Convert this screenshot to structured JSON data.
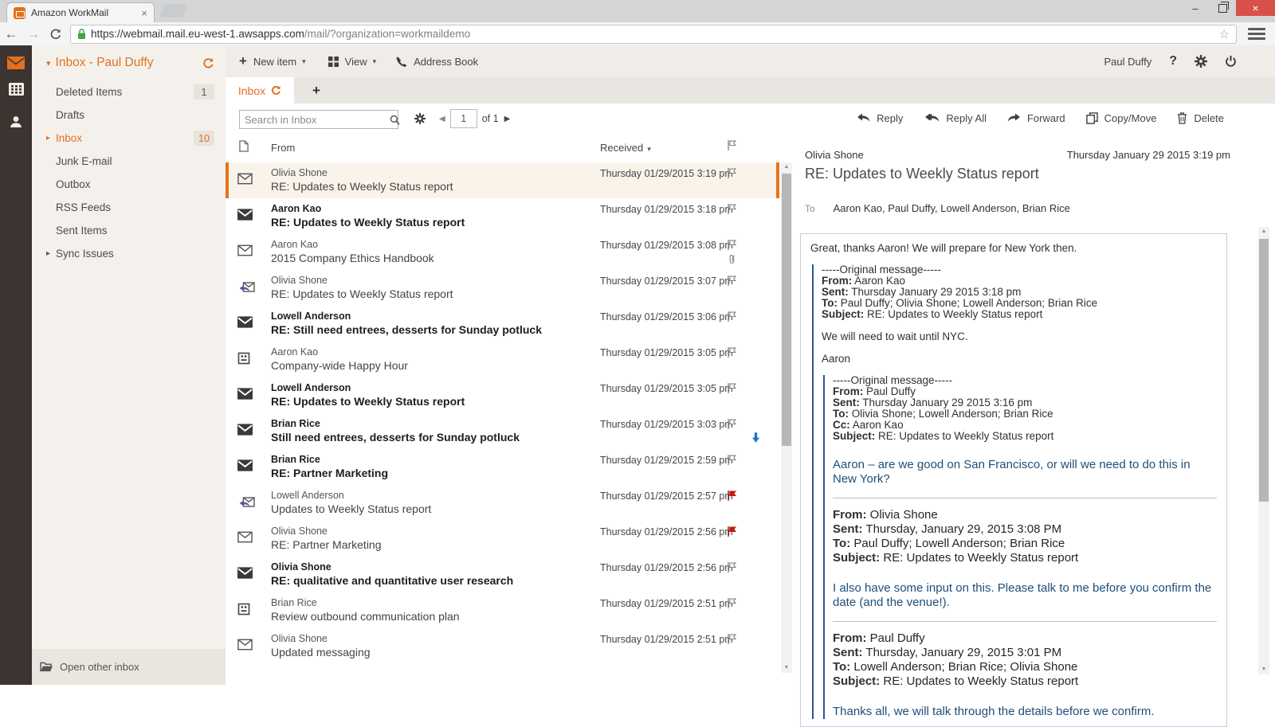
{
  "chrome": {
    "tab_title": "Amazon WorkMail",
    "url_host": "https://webmail.mail.eu-west-1.awsapps.com",
    "url_path": "/mail/?organization=workmaildemo",
    "window": {
      "minimize": "–",
      "close": "×"
    },
    "nav": {
      "back": "←",
      "forward": "→",
      "star": "☆"
    }
  },
  "icons": {
    "caret_down": "▾",
    "arrow_right_small": "▸",
    "prev_page": "◀",
    "next_page": "▶",
    "scroll_up": "▲",
    "scroll_down": "▼",
    "help": "?",
    "plus": "+",
    "tab_close": "×"
  },
  "sidebar": {
    "header": "Inbox - Paul Duffy",
    "folders": [
      {
        "label": "Deleted Items",
        "badge": "1",
        "state": ""
      },
      {
        "label": "Drafts",
        "state": ""
      },
      {
        "label": "Inbox",
        "badge": "10",
        "state": "active has-arrow"
      },
      {
        "label": "Junk E-mail",
        "state": ""
      },
      {
        "label": "Outbox",
        "state": ""
      },
      {
        "label": "RSS Feeds",
        "state": ""
      },
      {
        "label": "Sent Items",
        "state": ""
      },
      {
        "label": "Sync Issues",
        "state": "has-arrow"
      }
    ],
    "footer": "Open other inbox"
  },
  "toolbar": {
    "new_item": "New item",
    "view": "View",
    "address_book": "Address Book",
    "user": "Paul Duffy"
  },
  "tabs": {
    "active": "Inbox"
  },
  "list": {
    "search_placeholder": "Search in Inbox",
    "page": "1",
    "page_of": "of 1",
    "columns": {
      "from": "From",
      "received": "Received"
    },
    "emails": [
      {
        "from": "Olivia Shone",
        "subject": "RE: Updates to Weekly Status report",
        "received": "Thursday 01/29/2015 3:19 pm",
        "state": "read selected"
      },
      {
        "from": "Aaron Kao",
        "subject": "RE: Updates to Weekly Status report",
        "received": "Thursday 01/29/2015 3:18 pm",
        "state": "unread"
      },
      {
        "from": "Aaron Kao",
        "subject": "2015 Company Ethics Handbook",
        "received": "Thursday 01/29/2015 3:08 pm",
        "state": "read attachment"
      },
      {
        "from": "Olivia Shone",
        "subject": "RE: Updates to Weekly Status report",
        "received": "Thursday 01/29/2015 3:07 pm",
        "state": "replied"
      },
      {
        "from": "Lowell Anderson",
        "subject": "RE: Still need entrees, desserts for Sunday potluck",
        "received": "Thursday 01/29/2015 3:06 pm",
        "state": "unread"
      },
      {
        "from": "Aaron Kao",
        "subject": "Company-wide Happy Hour",
        "received": "Thursday 01/29/2015 3:05 pm",
        "state": "meeting"
      },
      {
        "from": "Lowell Anderson",
        "subject": "RE: Updates to Weekly Status report",
        "received": "Thursday 01/29/2015 3:05 pm",
        "state": "unread"
      },
      {
        "from": "Brian Rice",
        "subject": "Still need entrees, desserts for Sunday potluck",
        "received": "Thursday 01/29/2015 3:03 pm",
        "state": "unread low-importance"
      },
      {
        "from": "Brian Rice",
        "subject": "RE: Partner Marketing",
        "received": "Thursday 01/29/2015 2:59 pm",
        "state": "unread"
      },
      {
        "from": "Lowell Anderson",
        "subject": "Updates to Weekly Status report",
        "received": "Thursday 01/29/2015 2:57 pm",
        "state": "replied flagged"
      },
      {
        "from": "Olivia Shone",
        "subject": "RE: Partner Marketing",
        "received": "Thursday 01/29/2015 2:56 pm",
        "state": "read flagged"
      },
      {
        "from": "Olivia Shone",
        "subject": "RE: qualitative and quantitative user research",
        "received": "Thursday 01/29/2015 2:56 pm",
        "state": "unread"
      },
      {
        "from": "Brian Rice",
        "subject": "Review outbound communication plan",
        "received": "Thursday 01/29/2015 2:51 pm",
        "state": "meeting"
      },
      {
        "from": "Olivia Shone",
        "subject": "Updated messaging",
        "received": "Thursday 01/29/2015 2:51 pm",
        "state": "read"
      }
    ]
  },
  "reading": {
    "actions": {
      "reply": "Reply",
      "reply_all": "Reply All",
      "forward": "Forward",
      "copy_move": "Copy/Move",
      "delete": "Delete"
    },
    "sender": "Olivia Shone",
    "date": "Thursday January 29 2015 3:19 pm",
    "subject": "RE: Updates to Weekly Status report",
    "to_label": "To",
    "recipients": "Aaron Kao, Paul Duffy, Lowell Anderson, Brian Rice",
    "body": {
      "intro": "Great, thanks Aaron! We will prepare for New York then.",
      "quote1": {
        "separator": "-----Original message-----",
        "headers": [
          [
            "From:",
            "Aaron Kao"
          ],
          [
            "Sent:",
            "Thursday January 29 2015 3:18 pm"
          ],
          [
            "To:",
            "Paul Duffy; Olivia Shone; Lowell Anderson; Brian Rice"
          ],
          [
            "Subject:",
            "RE: Updates to Weekly Status report"
          ]
        ],
        "para1": "We will need to wait until NYC.",
        "para2": "Aaron"
      },
      "quote2": {
        "separator": "-----Original message-----",
        "headers": [
          [
            "From:",
            "Paul Duffy"
          ],
          [
            "Sent:",
            "Thursday January 29 2015 3:16 pm"
          ],
          [
            "To:",
            "Olivia Shone; Lowell Anderson; Brian Rice"
          ],
          [
            "Cc:",
            "Aaron Kao"
          ],
          [
            "Subject:",
            "RE: Updates to Weekly Status report"
          ]
        ],
        "blue1": "Aaron – are we good on San Francisco, or will we need to do this in New York?",
        "section2_headers": [
          [
            "From:",
            "Olivia Shone"
          ],
          [
            "Sent:",
            "Thursday, January 29, 2015 3:08 PM"
          ],
          [
            "To:",
            "Paul Duffy; Lowell Anderson; Brian Rice"
          ],
          [
            "Subject:",
            "RE: Updates to Weekly Status report"
          ]
        ],
        "blue2": "I also have some input on this.  Please talk to me before you confirm the date (and the venue!).",
        "section3_headers": [
          [
            "From:",
            "Paul Duffy"
          ],
          [
            "Sent:",
            "Thursday, January 29, 2015 3:01 PM"
          ],
          [
            "To:",
            "Lowell Anderson; Brian Rice; Olivia Shone"
          ],
          [
            "Subject:",
            "RE: Updates to Weekly Status report"
          ]
        ],
        "blue3": "Thanks all, we will talk through the details before we confirm."
      }
    }
  },
  "colors": {
    "accent_orange": "#e4701e",
    "rail_dark": "#3c3430",
    "panel_beige": "#f4f1ec",
    "flag_red": "#c11a0e",
    "quote_blue": "#1f4e79",
    "close_btn_red": "#d85148"
  }
}
